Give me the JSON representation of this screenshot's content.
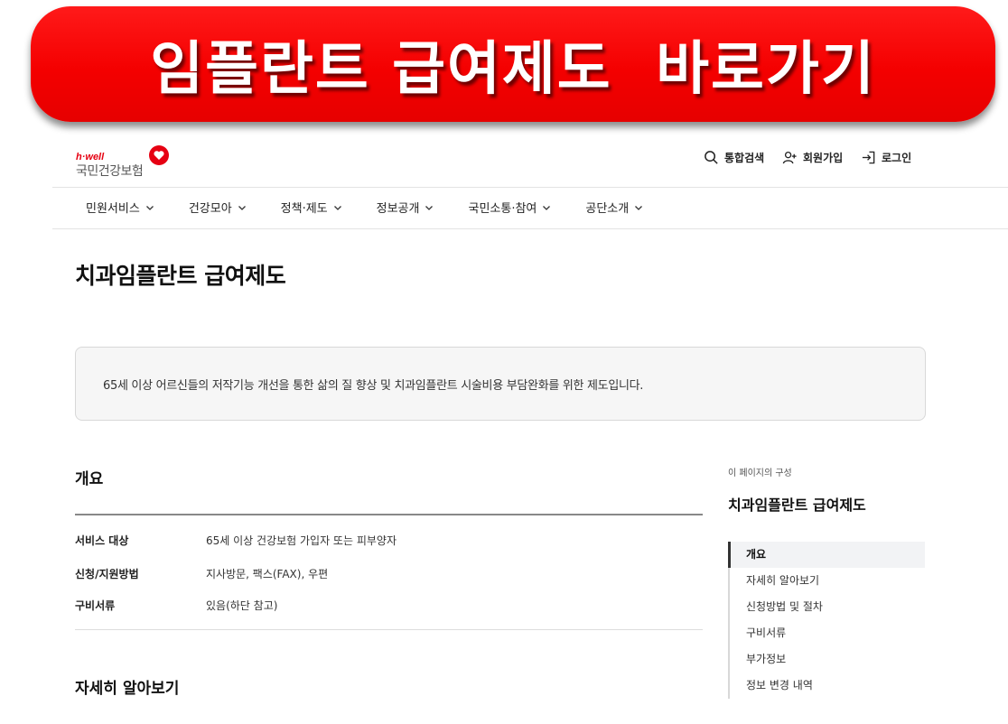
{
  "banner": {
    "text": "임플란트 급여제도  바로가기"
  },
  "logo": {
    "small": "h·well",
    "main": "국민건강보험"
  },
  "utility": {
    "search": "통합검색",
    "join": "회원가입",
    "login": "로그인"
  },
  "nav": [
    "민원서비스",
    "건강모아",
    "정책·제도",
    "정보공개",
    "국민소통·참여",
    "공단소개"
  ],
  "page": {
    "title": "치과임플란트 급여제도",
    "summary": "65세 이상 어르신들의 저작기능 개선을 통한 삶의 질 향상 및 치과임플란트 시술비용 부담완화를 위한 제도입니다."
  },
  "overview": {
    "title": "개요",
    "rows": [
      {
        "label": "서비스 대상",
        "value": "65세 이상 건강보험 가입자 또는 피부양자"
      },
      {
        "label": "신청/지원방법",
        "value": "지사방문, 팩스(FAX), 우편"
      },
      {
        "label": "구비서류",
        "value": "있음(하단 참고)"
      }
    ]
  },
  "details": {
    "title": "자세히 알아보기"
  },
  "toc": {
    "caption": "이 페이지의 구성",
    "title": "치과임플란트 급여제도",
    "items": [
      "개요",
      "자세히 알아보기",
      "신청방법 및 절차",
      "구비서류",
      "부가정보",
      "정보 변경 내역"
    ]
  },
  "colors": {
    "banner": "#f40000",
    "brand": "#e60012"
  }
}
